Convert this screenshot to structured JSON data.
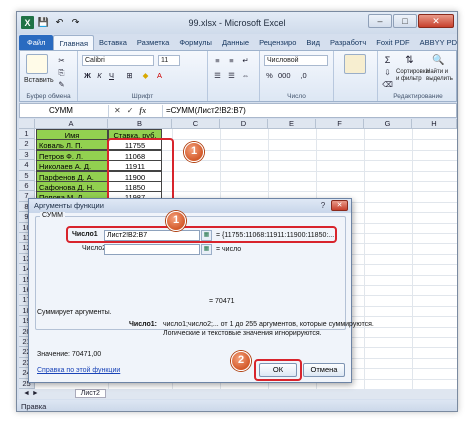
{
  "window": {
    "title": "99.xlsx - Microsoft Excel",
    "logo": "X",
    "minimize": "–",
    "maximize": "□",
    "close": "✕"
  },
  "tabs": [
    "Файл",
    "Главная",
    "Вставка",
    "Разметка",
    "Формулы",
    "Данные",
    "Рецензиро",
    "Вид",
    "Разработч",
    "Foxit PDF",
    "ABBYY PDF"
  ],
  "ribbon": {
    "paste": "Вставить",
    "clipboard": "Буфер обмена",
    "font_name": "Calibri",
    "font_size": "11",
    "number_format": "Числовой",
    "sort": "Сортировка и фильтр",
    "find": "Найти и выделить",
    "editing": "Редактирование",
    "font_group": "Шрифт",
    "number_group": "Число"
  },
  "formula_bar": {
    "name_box": "СУММ",
    "cancel": "✕",
    "enter": "✓",
    "fx": "fx",
    "formula": "=СУММ(Лист2!B2:B7)"
  },
  "columns": [
    "A",
    "B",
    "C",
    "D",
    "E",
    "F",
    "G",
    "H",
    "I"
  ],
  "rows": [
    "1",
    "2",
    "3",
    "4",
    "5",
    "6",
    "7",
    "8",
    "9",
    "10",
    "11",
    "12",
    "13",
    "14",
    "15",
    "16",
    "17",
    "18",
    "19",
    "20",
    "21",
    "22",
    "23",
    "24",
    "25"
  ],
  "table": {
    "header_name": "Имя",
    "header_rate": "Ставка, руб.",
    "names": [
      "Коваль Л. П.",
      "Петров Ф. Л.",
      "Николаев А. Д.",
      "Парфенов Д. А.",
      "Сафонова Д. Н.",
      "Попова М. Д."
    ],
    "values": [
      "11755",
      "11068",
      "11911",
      "11900",
      "11850",
      "11987"
    ]
  },
  "sheets": {
    "current": "Лист2"
  },
  "status": "Правка",
  "dialog": {
    "title": "Аргументы функции",
    "help": "?",
    "close": "✕",
    "function": "СУММ",
    "arg1_label": "Число1",
    "arg1_value": "Лист2!B2:B7",
    "arg1_result": "= {11755:11068:11911:11900:11850:...",
    "arg2_label": "Число2",
    "arg2_result": "= число",
    "total": "= 70471",
    "description": "Суммирует аргументы.",
    "arg_desc_name": "Число1:",
    "arg_desc_line1": "число1;число2;... от 1 до 255 аргументов, которые суммируются.",
    "arg_desc_line2": "Логические и текстовые значения игнорируются.",
    "value": "Значение: 70471,00",
    "help_link": "Справка по этой функции",
    "ok": "ОК",
    "cancel": "Отмена"
  },
  "badges": {
    "one": "1",
    "two": "2"
  }
}
